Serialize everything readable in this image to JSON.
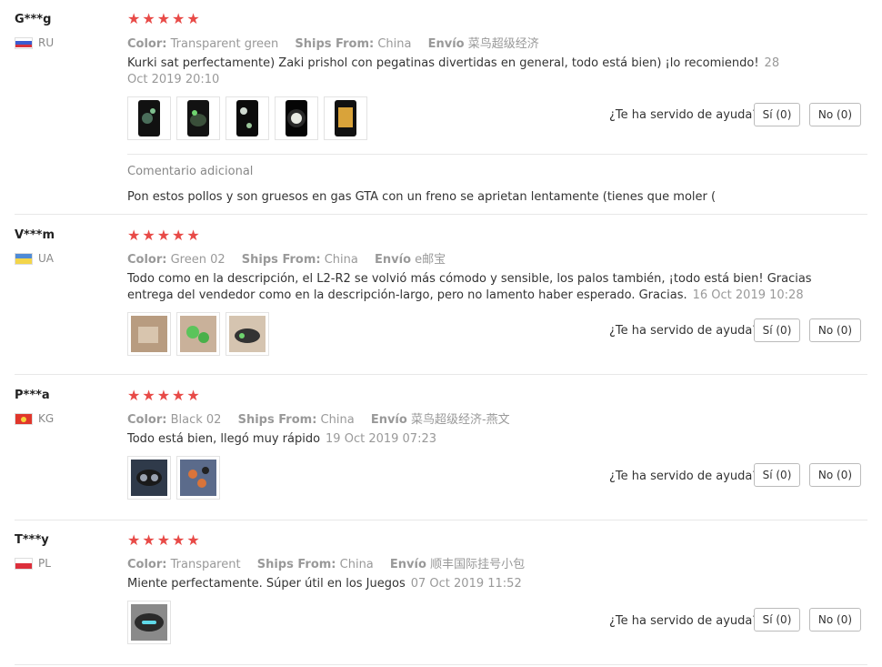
{
  "helpful_question": "¿Te ha servido de ayuda?",
  "star_color": "#e84a47",
  "reviews": [
    {
      "user": "G***g",
      "country": "RU",
      "flag": "russia-flag",
      "stars": "★★★★★",
      "color_label": "Color:",
      "color_value": "Transparent green",
      "ships_label": "Ships From:",
      "ships_value": "China",
      "envio_label": "Envío",
      "envio_value": "菜鸟超级经济",
      "text": "Kurki sat perfectamente) Zaki prishol con pegatinas divertidas en general, todo está bien) ¡lo recomiendo!",
      "date": "28 Oct 2019 20:10",
      "yes": "Sí (0)",
      "no": "No (0)",
      "additional_title": "Comentario adicional",
      "additional_text": "Pon estos pollos y son gruesos en gas GTA con un freno se aprietan lentamente (tienes que moler ("
    },
    {
      "user": "V***m",
      "country": "UA",
      "flag": "ukraine-flag",
      "stars": "★★★★★",
      "color_label": "Color:",
      "color_value": "Green 02",
      "ships_label": "Ships From:",
      "ships_value": "China",
      "envio_label": "Envío",
      "envio_value": "e邮宝",
      "text_line1": "Todo como en la descripción, el L2-R2 se volvió más cómodo y sensible, los palos también, ¡todo está bien! Gracias",
      "text_line2": "entrega del vendedor como en la descripción-largo, pero no lamento haber esperado. Gracias.",
      "date": "16 Oct 2019 10:28",
      "yes": "Sí (0)",
      "no": "No (0)"
    },
    {
      "user": "P***a",
      "country": "KG",
      "flag": "kyrgyzstan-flag",
      "stars": "★★★★★",
      "color_label": "Color:",
      "color_value": "Black 02",
      "ships_label": "Ships From:",
      "ships_value": "China",
      "envio_label": "Envío",
      "envio_value": "菜鸟超级经济-燕文",
      "text": "Todo está bien, llegó muy rápido",
      "date": "19 Oct 2019 07:23",
      "yes": "Sí (0)",
      "no": "No (0)"
    },
    {
      "user": "T***y",
      "country": "PL",
      "flag": "poland-flag",
      "stars": "★★★★★",
      "color_label": "Color:",
      "color_value": "Transparent",
      "ships_label": "Ships From:",
      "ships_value": "China",
      "envio_label": "Envío",
      "envio_value": "顺丰国际挂号小包",
      "text": "Miente perfectamente. Súper útil en los Juegos",
      "date": "07 Oct 2019 11:52",
      "yes": "Sí (0)",
      "no": "No (0)"
    }
  ]
}
